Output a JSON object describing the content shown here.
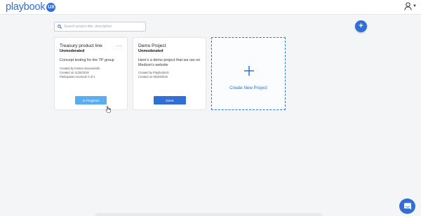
{
  "header": {
    "logo_text": "playbook",
    "logo_badge": "UX"
  },
  "search": {
    "placeholder": "Search project title, description"
  },
  "add_button": {
    "label": "+"
  },
  "projects": [
    {
      "title": "Treasury product line",
      "moderation": "Unmoderated",
      "description": "Concept testing for the TP group",
      "created_by": "Created by Kristen Giovanniello",
      "created_on": "Created on 11/20/2019",
      "participants": "Participants received: 0 of 1",
      "menu": "...",
      "status_button": "In Progress"
    },
    {
      "title": "Demo Project",
      "moderation": "Unmoderated",
      "description": "Here's a demo project that we ran on Medium's website",
      "created_by": "Created by PlaybookUX",
      "created_on": "Created on 06/20/2019",
      "status_button": "Done"
    }
  ],
  "create_card": {
    "plus": "+",
    "label": "Create New Project"
  },
  "colors": {
    "brand": "#2f6fd6",
    "in_progress": "#58aef0",
    "background": "#f4f5f7"
  },
  "icons": [
    "search-icon",
    "user-icon",
    "plus-icon",
    "chat-icon",
    "pointer-cursor-icon"
  ]
}
